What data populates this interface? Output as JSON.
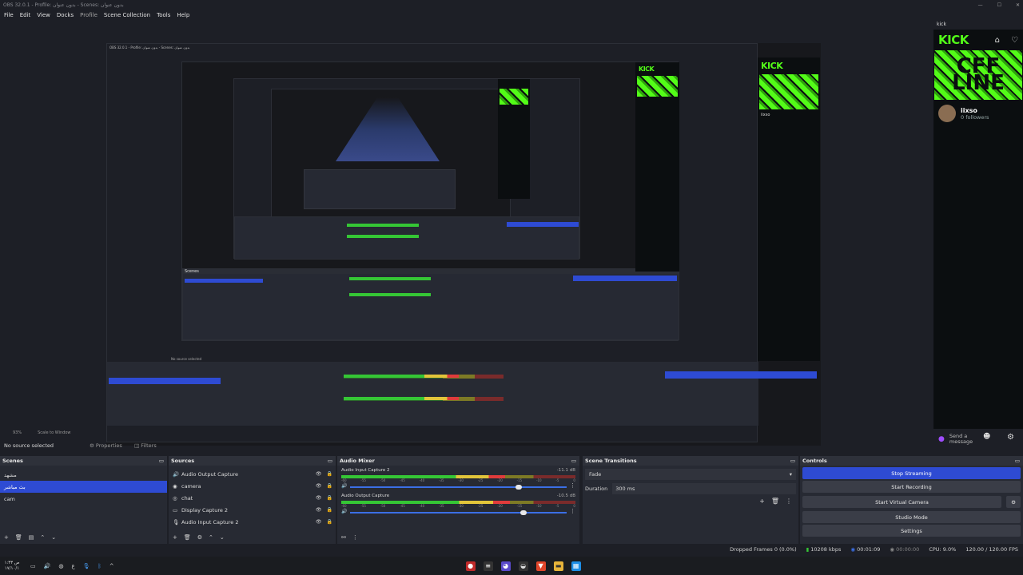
{
  "window": {
    "title": "OBS 32.0.1 - Profile: بدون عنوان - Scenes: بدون عنوان",
    "menu": [
      "File",
      "Edit",
      "View",
      "Docks",
      "Profile",
      "Scene Collection",
      "Tools",
      "Help"
    ]
  },
  "preview": {
    "zoom": "93%",
    "scale_label": "Scale to Window"
  },
  "kick": {
    "dock_title": "kick",
    "logo": "KICK",
    "banner_text_1": "CFF",
    "banner_text_2": "LINE",
    "username": "iixso",
    "followers": "0 followers",
    "send_message": "Send a message"
  },
  "sourcebar": {
    "no_source": "No source selected",
    "properties": "Properties",
    "filters": "Filters"
  },
  "scenes": {
    "title": "Scenes",
    "items": [
      "مشهد",
      "بث مباشر",
      "cam"
    ],
    "selected": 1
  },
  "sources": {
    "title": "Sources",
    "items": [
      {
        "icon": "audio-output-icon",
        "label": "Audio Output Capture"
      },
      {
        "icon": "camera-icon",
        "label": "camera"
      },
      {
        "icon": "browser-icon",
        "label": "chat"
      },
      {
        "icon": "monitor-icon",
        "label": "Display Capture 2"
      },
      {
        "icon": "microphone-icon",
        "label": "Audio Input Capture 2"
      }
    ]
  },
  "mixer": {
    "title": "Audio Mixer",
    "channels": [
      {
        "name": "Audio Input Capture 2",
        "db": "-11.1 dB",
        "level": 0.7,
        "volume": 0.78
      },
      {
        "name": "Audio Output Capture",
        "db": "-10.5 dB",
        "level": 0.72,
        "volume": 0.8
      }
    ],
    "ticks": [
      "-60",
      "-55",
      "-50",
      "-45",
      "-40",
      "-35",
      "-30",
      "-25",
      "-20",
      "-15",
      "-10",
      "-5",
      "0"
    ]
  },
  "transitions": {
    "title": "Scene Transitions",
    "type": "Fade",
    "duration_label": "Duration",
    "duration_value": "300 ms"
  },
  "controls": {
    "title": "Controls",
    "buttons": [
      "Stop Streaming",
      "Start Recording",
      "Start Virtual Camera",
      "Studio Mode",
      "Settings"
    ]
  },
  "status": {
    "dropped": "Dropped Frames 0 (0.0%)",
    "bitrate": "10208 kbps",
    "stream_time": "00:01:09",
    "rec_time": "00:00:00",
    "cpu": "CPU: 9.0%",
    "fps": "120.00 / 120.00 FPS"
  },
  "taskbar": {
    "clock_time": "۱:۳۳ ص",
    "clock_date": "۱۷/۱۰/۱"
  }
}
